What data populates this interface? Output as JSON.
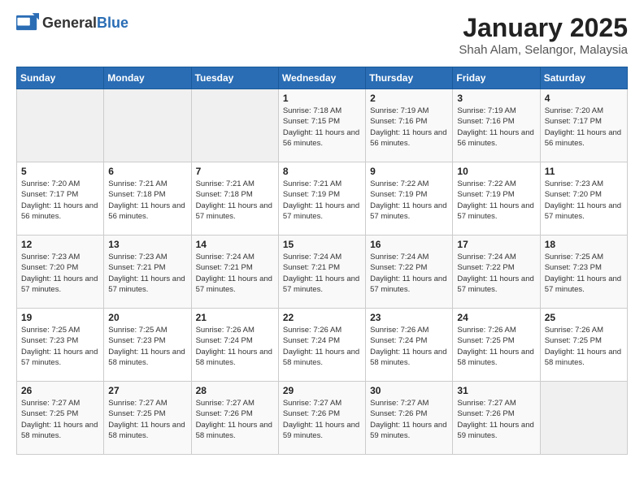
{
  "header": {
    "logo_general": "General",
    "logo_blue": "Blue",
    "title": "January 2025",
    "subtitle": "Shah Alam, Selangor, Malaysia"
  },
  "days_of_week": [
    "Sunday",
    "Monday",
    "Tuesday",
    "Wednesday",
    "Thursday",
    "Friday",
    "Saturday"
  ],
  "weeks": [
    [
      {
        "day": "",
        "info": ""
      },
      {
        "day": "",
        "info": ""
      },
      {
        "day": "",
        "info": ""
      },
      {
        "day": "1",
        "info": "Sunrise: 7:18 AM\nSunset: 7:15 PM\nDaylight: 11 hours\nand 56 minutes."
      },
      {
        "day": "2",
        "info": "Sunrise: 7:19 AM\nSunset: 7:16 PM\nDaylight: 11 hours\nand 56 minutes."
      },
      {
        "day": "3",
        "info": "Sunrise: 7:19 AM\nSunset: 7:16 PM\nDaylight: 11 hours\nand 56 minutes."
      },
      {
        "day": "4",
        "info": "Sunrise: 7:20 AM\nSunset: 7:17 PM\nDaylight: 11 hours\nand 56 minutes."
      }
    ],
    [
      {
        "day": "5",
        "info": "Sunrise: 7:20 AM\nSunset: 7:17 PM\nDaylight: 11 hours\nand 56 minutes."
      },
      {
        "day": "6",
        "info": "Sunrise: 7:21 AM\nSunset: 7:18 PM\nDaylight: 11 hours\nand 56 minutes."
      },
      {
        "day": "7",
        "info": "Sunrise: 7:21 AM\nSunset: 7:18 PM\nDaylight: 11 hours\nand 57 minutes."
      },
      {
        "day": "8",
        "info": "Sunrise: 7:21 AM\nSunset: 7:19 PM\nDaylight: 11 hours\nand 57 minutes."
      },
      {
        "day": "9",
        "info": "Sunrise: 7:22 AM\nSunset: 7:19 PM\nDaylight: 11 hours\nand 57 minutes."
      },
      {
        "day": "10",
        "info": "Sunrise: 7:22 AM\nSunset: 7:19 PM\nDaylight: 11 hours\nand 57 minutes."
      },
      {
        "day": "11",
        "info": "Sunrise: 7:23 AM\nSunset: 7:20 PM\nDaylight: 11 hours\nand 57 minutes."
      }
    ],
    [
      {
        "day": "12",
        "info": "Sunrise: 7:23 AM\nSunset: 7:20 PM\nDaylight: 11 hours\nand 57 minutes."
      },
      {
        "day": "13",
        "info": "Sunrise: 7:23 AM\nSunset: 7:21 PM\nDaylight: 11 hours\nand 57 minutes."
      },
      {
        "day": "14",
        "info": "Sunrise: 7:24 AM\nSunset: 7:21 PM\nDaylight: 11 hours\nand 57 minutes."
      },
      {
        "day": "15",
        "info": "Sunrise: 7:24 AM\nSunset: 7:21 PM\nDaylight: 11 hours\nand 57 minutes."
      },
      {
        "day": "16",
        "info": "Sunrise: 7:24 AM\nSunset: 7:22 PM\nDaylight: 11 hours\nand 57 minutes."
      },
      {
        "day": "17",
        "info": "Sunrise: 7:24 AM\nSunset: 7:22 PM\nDaylight: 11 hours\nand 57 minutes."
      },
      {
        "day": "18",
        "info": "Sunrise: 7:25 AM\nSunset: 7:23 PM\nDaylight: 11 hours\nand 57 minutes."
      }
    ],
    [
      {
        "day": "19",
        "info": "Sunrise: 7:25 AM\nSunset: 7:23 PM\nDaylight: 11 hours\nand 57 minutes."
      },
      {
        "day": "20",
        "info": "Sunrise: 7:25 AM\nSunset: 7:23 PM\nDaylight: 11 hours\nand 58 minutes."
      },
      {
        "day": "21",
        "info": "Sunrise: 7:26 AM\nSunset: 7:24 PM\nDaylight: 11 hours\nand 58 minutes."
      },
      {
        "day": "22",
        "info": "Sunrise: 7:26 AM\nSunset: 7:24 PM\nDaylight: 11 hours\nand 58 minutes."
      },
      {
        "day": "23",
        "info": "Sunrise: 7:26 AM\nSunset: 7:24 PM\nDaylight: 11 hours\nand 58 minutes."
      },
      {
        "day": "24",
        "info": "Sunrise: 7:26 AM\nSunset: 7:25 PM\nDaylight: 11 hours\nand 58 minutes."
      },
      {
        "day": "25",
        "info": "Sunrise: 7:26 AM\nSunset: 7:25 PM\nDaylight: 11 hours\nand 58 minutes."
      }
    ],
    [
      {
        "day": "26",
        "info": "Sunrise: 7:27 AM\nSunset: 7:25 PM\nDaylight: 11 hours\nand 58 minutes."
      },
      {
        "day": "27",
        "info": "Sunrise: 7:27 AM\nSunset: 7:25 PM\nDaylight: 11 hours\nand 58 minutes."
      },
      {
        "day": "28",
        "info": "Sunrise: 7:27 AM\nSunset: 7:26 PM\nDaylight: 11 hours\nand 58 minutes."
      },
      {
        "day": "29",
        "info": "Sunrise: 7:27 AM\nSunset: 7:26 PM\nDaylight: 11 hours\nand 59 minutes."
      },
      {
        "day": "30",
        "info": "Sunrise: 7:27 AM\nSunset: 7:26 PM\nDaylight: 11 hours\nand 59 minutes."
      },
      {
        "day": "31",
        "info": "Sunrise: 7:27 AM\nSunset: 7:26 PM\nDaylight: 11 hours\nand 59 minutes."
      },
      {
        "day": "",
        "info": ""
      }
    ]
  ]
}
